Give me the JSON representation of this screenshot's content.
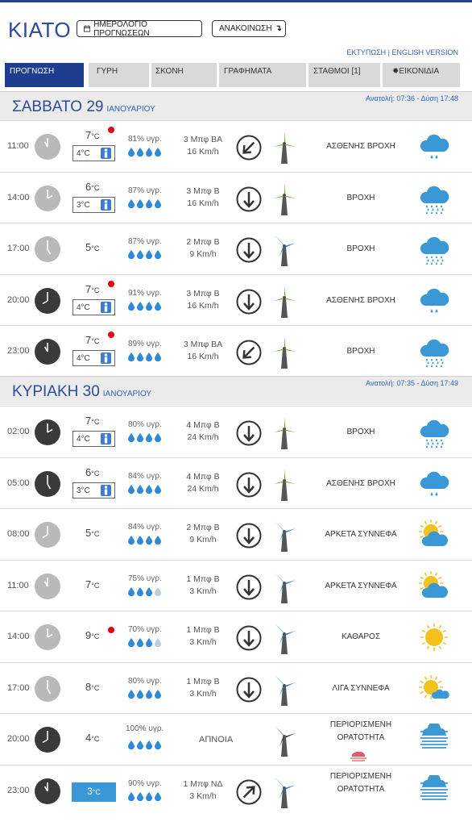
{
  "header": {
    "city": "ΚΙΑΤΟ",
    "calendar_button": "ΗΜΕΡΟΛΟΓΙΟ ΠΡΟΓΝΩΣΕΩΝ",
    "announcement_button": "ΑΝΑΚΟΙΝΩΣΗ",
    "links": "ΕΚΤΥΠΩΣΗ | ENGLISH VERSION"
  },
  "tabs": [
    "ΠΡΟΓΝΩΣΗ",
    "ΓΥΡΗ",
    "ΣΚΟΝΗ",
    "ΓΡΑΦΗΜΑΤΑ",
    "ΣΤΑΘΜΟΙ [1]",
    "ΕΙΚΟΝΙΔΙΑ"
  ],
  "days": [
    {
      "name": "ΣΑΒΒΑΤΟ 29",
      "month": "ΙΑΝΟΥΑΡΙΟΥ",
      "sun": "Ανατολή: 07:36 - Δύση 17:48",
      "rows": [
        {
          "time": "11:00",
          "temp": "7",
          "feels": "4°C",
          "hum": "81% υγρ.",
          "wind1": "3 Μπφ ΒΑ",
          "wind2": "16 Km/h",
          "cond": "ΑΣΘΕΝΗΣ ΒΡΟΧΗ"
        },
        {
          "time": "14:00",
          "temp": "6",
          "feels": "3°C",
          "hum": "87% υγρ.",
          "wind1": "3 Μπφ Β",
          "wind2": "16 Km/h",
          "cond": "ΒΡΟΧΗ"
        },
        {
          "time": "17:00",
          "temp": "5",
          "hum": "87% υγρ.",
          "wind1": "2 Μπφ Β",
          "wind2": "9 Km/h",
          "cond": "ΒΡΟΧΗ"
        },
        {
          "time": "20:00",
          "temp": "7",
          "feels": "4°C",
          "hum": "91% υγρ.",
          "wind1": "3 Μπφ Β",
          "wind2": "16 Km/h",
          "cond": "ΑΣΘΕΝΗΣ ΒΡΟΧΗ"
        },
        {
          "time": "23:00",
          "temp": "7",
          "feels": "4°C",
          "hum": "89% υγρ.",
          "wind1": "3 Μπφ ΒΑ",
          "wind2": "16 Km/h",
          "cond": "ΒΡΟΧΗ"
        }
      ]
    },
    {
      "name": "ΚΥΡΙΑΚΗ 30",
      "month": "ΙΑΝΟΥΑΡΙΟΥ",
      "sun": "Ανατολή: 07:35 - Δύση 17:49",
      "rows": [
        {
          "time": "02:00",
          "temp": "7",
          "feels": "4°C",
          "hum": "80% υγρ.",
          "wind1": "4 Μπφ Β",
          "wind2": "24 Km/h",
          "cond": "ΒΡΟΧΗ"
        },
        {
          "time": "05:00",
          "temp": "6",
          "feels": "3°C",
          "hum": "84% υγρ.",
          "wind1": "4 Μπφ Β",
          "wind2": "24 Km/h",
          "cond": "ΑΣΘΕΝΗΣ ΒΡΟΧΗ"
        },
        {
          "time": "08:00",
          "temp": "5",
          "hum": "84% υγρ.",
          "wind1": "2 Μπφ Β",
          "wind2": "9 Km/h",
          "cond": "ΑΡΚΕΤΑ ΣΥΝΝΕΦΑ"
        },
        {
          "time": "11:00",
          "temp": "7",
          "hum": "75% υγρ.",
          "wind1": "1 Μπφ Β",
          "wind2": "3 Km/h",
          "cond": "ΑΡΚΕΤΑ ΣΥΝΝΕΦΑ"
        },
        {
          "time": "14:00",
          "temp": "9",
          "hum": "70% υγρ.",
          "wind1": "1 Μπφ Β",
          "wind2": "3 Km/h",
          "cond": "ΚΑΘΑΡΟΣ"
        },
        {
          "time": "17:00",
          "temp": "8",
          "hum": "80% υγρ.",
          "wind1": "1 Μπφ Β",
          "wind2": "3 Km/h",
          "cond": "ΛΙΓΑ ΣΥΝΝΕΦΑ"
        },
        {
          "time": "20:00",
          "temp": "4",
          "hum": "100% υγρ.",
          "calm": "ΑΠΝΟΙΑ",
          "cond1": "ΠΕΡΙΟΡΙΣΜΕΝΗ",
          "cond2": "ΟΡΑΤΟΤΗΤΑ"
        },
        {
          "time": "23:00",
          "temp": "3",
          "hum": "90% υγρ.",
          "wind1": "1 Μπφ ΝΔ",
          "wind2": "3 Km/h",
          "cond1": "ΠΕΡΙΟΡΙΣΜΕΝΗ",
          "cond2": "ΟΡΑΤΟΤΗΤΑ"
        }
      ]
    }
  ],
  "unit": "°C"
}
